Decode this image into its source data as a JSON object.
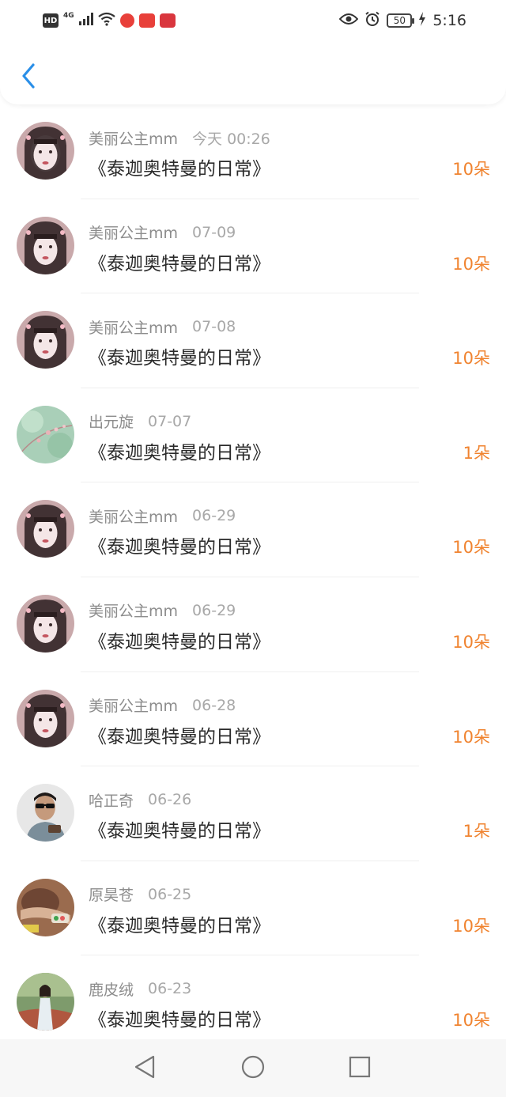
{
  "status_bar": {
    "hd": "HD",
    "network": "4G",
    "battery": "50",
    "time": "5:16"
  },
  "nav": {
    "back_icon": "chevron-left-icon"
  },
  "colors": {
    "accent_blue": "#2a8fe8",
    "amount_orange": "#f0832f",
    "name_gray": "#8c8c8c",
    "title_dark": "#2b2b2b"
  },
  "records": [
    {
      "user": "美丽公主mm",
      "time": "今天 00:26",
      "book": "《泰迦奥特曼的日常》",
      "amount": "10朵",
      "avatar": "pink-girl"
    },
    {
      "user": "美丽公主mm",
      "time": "07-09",
      "book": "《泰迦奥特曼的日常》",
      "amount": "10朵",
      "avatar": "pink-girl"
    },
    {
      "user": "美丽公主mm",
      "time": "07-08",
      "book": "《泰迦奥特曼的日常》",
      "amount": "10朵",
      "avatar": "pink-girl"
    },
    {
      "user": "出元旋",
      "time": "07-07",
      "book": "《泰迦奥特曼的日常》",
      "amount": "1朵",
      "avatar": "green-flower"
    },
    {
      "user": "美丽公主mm",
      "time": "06-29",
      "book": "《泰迦奥特曼的日常》",
      "amount": "10朵",
      "avatar": "pink-girl"
    },
    {
      "user": "美丽公主mm",
      "time": "06-29",
      "book": "《泰迦奥特曼的日常》",
      "amount": "10朵",
      "avatar": "pink-girl"
    },
    {
      "user": "美丽公主mm",
      "time": "06-28",
      "book": "《泰迦奥特曼的日常》",
      "amount": "10朵",
      "avatar": "pink-girl"
    },
    {
      "user": "哈正奇",
      "time": "06-26",
      "book": "《泰迦奥特曼的日常》",
      "amount": "1朵",
      "avatar": "sunglasses-man"
    },
    {
      "user": "原昊苍",
      "time": "06-25",
      "book": "《泰迦奥特曼的日常》",
      "amount": "10朵",
      "avatar": "brown-hands"
    },
    {
      "user": "鹿皮绒",
      "time": "06-23",
      "book": "《泰迦奥特曼的日常》",
      "amount": "10朵",
      "avatar": "outdoor-woman"
    }
  ]
}
